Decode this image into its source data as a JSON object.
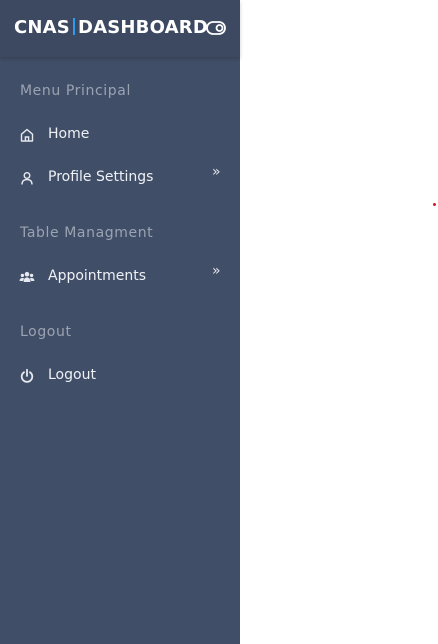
{
  "brand": {
    "part1": "CNAS",
    "part2": "DASHBOARD",
    "accent_color": "#2f9cf0",
    "toggle_icon": "toggle-switch-icon"
  },
  "sidebar": {
    "background": "#414e67",
    "sections": [
      {
        "title": "Menu Principal",
        "items": [
          {
            "label": "Home",
            "icon": "home-icon"
          },
          {
            "label": "Profile Settings",
            "icon": "user-icon",
            "expand_icon": "»"
          }
        ]
      },
      {
        "title": "Table Managment",
        "items": [
          {
            "label": "Appointments",
            "icon": "users-group-icon",
            "expand_icon": "»"
          }
        ]
      },
      {
        "title": "Logout",
        "items": [
          {
            "label": "Logout",
            "icon": "power-icon"
          }
        ]
      }
    ]
  }
}
